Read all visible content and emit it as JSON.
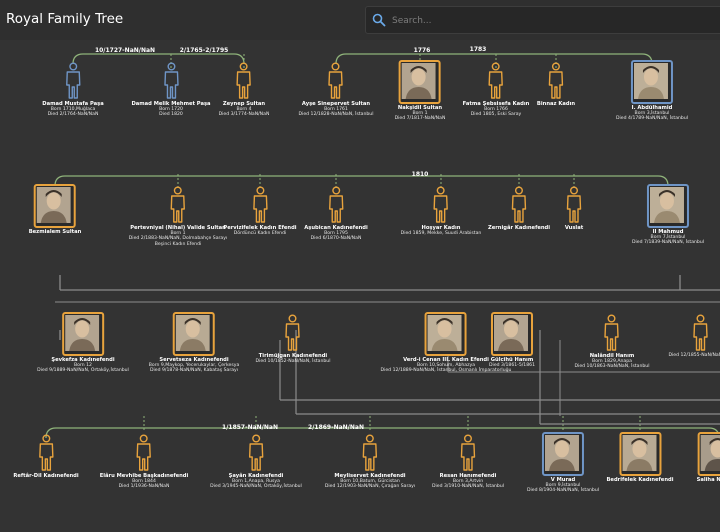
{
  "app": {
    "title": "Royal Family Tree"
  },
  "search": {
    "placeholder": "Search..."
  },
  "colors": {
    "female": "#e8a33d",
    "male": "#6f95c6",
    "marriage": "#8fb37a",
    "child": "#8c8c8c",
    "background": "#333333"
  },
  "union_labels": [
    "10/1727-NaN/NaN",
    "2/1765-2/1795",
    "1776",
    "1783",
    "1810",
    "1/1857-NaN/NaN",
    "2/1869-NaN/NaN"
  ],
  "people": [
    {
      "name": "Damad Mustafa Paşa",
      "lines": [
        "Born 1710,Muğlaca",
        "Died 2/1764-NaN/NaN"
      ],
      "gender": "male",
      "photo": false
    },
    {
      "name": "Damad Melik Mehmet Paşa",
      "lines": [
        "Born 1720",
        "Died 1820"
      ],
      "gender": "male",
      "photo": false
    },
    {
      "name": "Zeynep Sultan",
      "lines": [
        "Born 4",
        "Died 3/1774-NaN/NaN"
      ],
      "gender": "female",
      "photo": false
    },
    {
      "name": "Ayşe Sinepervet Sultan",
      "lines": [
        "Born 1761",
        "Died 12/1828-NaN/NaN, İstanbul"
      ],
      "gender": "female",
      "photo": false
    },
    {
      "name": "Nakşidil Sultan",
      "lines": [
        "Born 1",
        "Died 7/1817-NaN/NaN"
      ],
      "gender": "female",
      "photo": true
    },
    {
      "name": "Fatma Şebsisefa Kadın",
      "lines": [
        "Born 1766",
        "Died 1805, Eski Saray"
      ],
      "gender": "female",
      "photo": false
    },
    {
      "name": "Binnaz Kadın",
      "lines": [],
      "gender": "female",
      "photo": false
    },
    {
      "name": "I. Abdülhamid",
      "lines": [
        "Born 3,İstanbul",
        "Died 4/1789-NaN/NaN, İstanbul"
      ],
      "gender": "male",
      "photo": true
    },
    {
      "name": "Bezmialem Sultan",
      "lines": [],
      "gender": "female",
      "photo": true
    },
    {
      "name": "Pertevniyal (Nihal) Valide Sultan",
      "lines": [
        "Born 1",
        "Died 2/1883-NaN/NaN, Dolmabahçe Sarayı",
        "Beşinci Kadın Efendi"
      ],
      "gender": "female",
      "photo": false
    },
    {
      "name": "Pervizifelek Kadın Efendi",
      "lines": [
        "Dördüncü Kadın Efendi"
      ],
      "gender": "female",
      "photo": false
    },
    {
      "name": "Aşubican Kadınefendi",
      "lines": [
        "Born 1795",
        "Died 6/1870-NaN/NaN"
      ],
      "gender": "female",
      "photo": false
    },
    {
      "name": "Hoşyar Kadın",
      "lines": [
        "Died 1859, Mekke, Suudi Arabistan"
      ],
      "gender": "female",
      "photo": false
    },
    {
      "name": "Zernigâr Kadınefendi",
      "lines": [],
      "gender": "female",
      "photo": false
    },
    {
      "name": "Vuslat",
      "lines": [],
      "gender": "female",
      "photo": false
    },
    {
      "name": "II Mahmud",
      "lines": [
        "Born 7,İstanbul",
        "Died 7/1839-NaN/NaN, İstanbul"
      ],
      "gender": "male",
      "photo": true
    },
    {
      "name": "Şevkefza Kadınefendi",
      "lines": [
        "Born 12",
        "Died 9/1889-NaN/NaN, Ortaköy,İstanbul"
      ],
      "gender": "female",
      "photo": true
    },
    {
      "name": "Servetseza Kadınefendi",
      "lines": [
        "Born 9,Maykop, Yecerukaylar, Çerkesya",
        "Died 9/1878-NaN/NaN, Kabataş Sarayı"
      ],
      "gender": "female",
      "photo": true
    },
    {
      "name": "Tirimüjgan Kadınefendi",
      "lines": [
        "Died 10/1852-NaN/NaN, İstanbul"
      ],
      "gender": "female",
      "photo": false
    },
    {
      "name": "Verd-i Cenan III. Kadın Efendi",
      "lines": [
        "Born 10,Sohum, Abhazya",
        "Died 12/1889-NaN/NaN, İstanbul, Osmanlı İmparatorluğu"
      ],
      "gender": "female",
      "photo": true
    },
    {
      "name": "Gülcihü Hanım",
      "lines": [
        "Died 3/1861-5/1861"
      ],
      "gender": "female",
      "photo": true
    },
    {
      "name": "Nalândil Hanım",
      "lines": [
        "Born 1829,Anapa",
        "Died 10/1863-NaN/NaN, İstanbul"
      ],
      "gender": "female",
      "photo": false
    },
    {
      "name": "",
      "lines": [
        "Died 12/1855-NaN/NaN, İsk"
      ],
      "gender": "female",
      "photo": false
    },
    {
      "name": "Reftâr-Dil Kadınefendi",
      "lines": [],
      "gender": "female",
      "photo": false
    },
    {
      "name": "Elâru Mevhibe Başkadınefendi",
      "lines": [
        "Born 1844",
        "Died 1/1936-NaN/NaN"
      ],
      "gender": "female",
      "photo": false
    },
    {
      "name": "Şayân Kadınefendi",
      "lines": [
        "Born 1,Anapa, Rusya",
        "Died 3/1945-NaN/NaN, Ortaköy,İstanbul"
      ],
      "gender": "female",
      "photo": false
    },
    {
      "name": "Meyliservet Kadınefendi",
      "lines": [
        "Born 10,Batum, Gürcistan",
        "Died 12/1903-NaN/NaN, Çırağan Sarayı"
      ],
      "gender": "female",
      "photo": false
    },
    {
      "name": "Resan Hanımefendi",
      "lines": [
        "Born 3,Artvin",
        "Died 3/1910-NaN/NaN, İstanbul"
      ],
      "gender": "female",
      "photo": false
    },
    {
      "name": "V Murad",
      "lines": [
        "Born 9,İstanbul",
        "Died 8/1904-NaN/NaN, İstanbul"
      ],
      "gender": "male",
      "photo": true
    },
    {
      "name": "Bedrifelek Kadınefendi",
      "lines": [],
      "gender": "female",
      "photo": true
    },
    {
      "name": "Saliha Naciye E",
      "lines": [],
      "gender": "female",
      "photo": true
    }
  ]
}
